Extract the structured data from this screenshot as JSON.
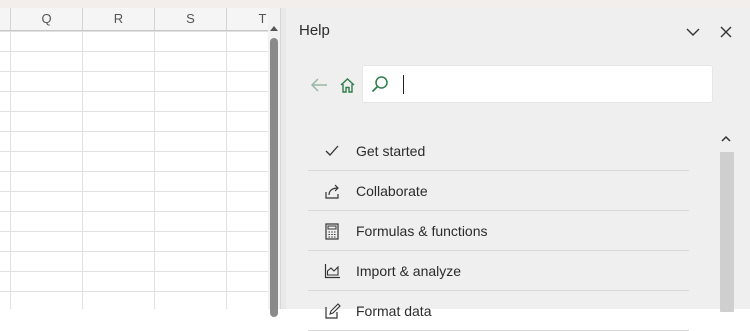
{
  "spreadsheet": {
    "columns": [
      "Q",
      "R",
      "S",
      "T"
    ]
  },
  "help_pane": {
    "title": "Help",
    "search": {
      "value": "",
      "placeholder": ""
    },
    "items": [
      {
        "label": "Get started",
        "icon": "checkmark-icon"
      },
      {
        "label": "Collaborate",
        "icon": "share-icon"
      },
      {
        "label": "Formulas & functions",
        "icon": "calculator-icon"
      },
      {
        "label": "Import & analyze",
        "icon": "chart-icon"
      },
      {
        "label": "Format data",
        "icon": "edit-icon"
      }
    ]
  },
  "colors": {
    "pane_background": "#efefef",
    "accent_green": "#2f7d4a",
    "back_arrow": "#9ab8a4"
  }
}
